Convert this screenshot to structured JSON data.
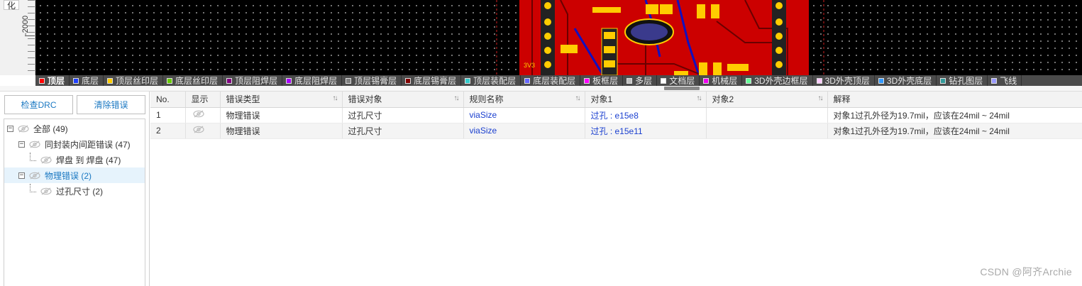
{
  "ruler": {
    "button_label": "化",
    "mark_label": "-2000"
  },
  "canvas": {
    "silk_label": "3V3"
  },
  "layers": [
    {
      "name": "顶层",
      "color": "#ff0000",
      "active": true
    },
    {
      "name": "底层",
      "color": "#1f3fff",
      "active": false
    },
    {
      "name": "顶层丝印层",
      "color": "#ffcc00",
      "active": false
    },
    {
      "name": "底层丝印层",
      "color": "#66cc00",
      "active": false
    },
    {
      "name": "顶层阻焊层",
      "color": "#800080",
      "active": false
    },
    {
      "name": "底层阻焊层",
      "color": "#aa00ff",
      "active": false
    },
    {
      "name": "顶层锡膏层",
      "color": "#808080",
      "active": false
    },
    {
      "name": "底层锡膏层",
      "color": "#800000",
      "active": false
    },
    {
      "name": "顶层装配层",
      "color": "#33cccc",
      "active": false
    },
    {
      "name": "底层装配层",
      "color": "#6666ff",
      "active": false
    },
    {
      "name": "板框层",
      "color": "#ff00ff",
      "active": false
    },
    {
      "name": "多层",
      "color": "#c0c0c0",
      "active": false
    },
    {
      "name": "文档层",
      "color": "#ffffff",
      "active": false
    },
    {
      "name": "机械层",
      "color": "#f000f0",
      "active": false
    },
    {
      "name": "3D外壳边框层",
      "color": "#66ff99",
      "active": false
    },
    {
      "name": "3D外壳顶层",
      "color": "#ffccff",
      "active": false
    },
    {
      "name": "3D外壳底层",
      "color": "#3399ff",
      "active": false
    },
    {
      "name": "钻孔图层",
      "color": "#339999",
      "active": false
    },
    {
      "name": "飞线",
      "color": "#9999ff",
      "active": false
    }
  ],
  "drc_panel": {
    "check_label": "检查DRC",
    "clear_label": "清除错误",
    "tree": [
      {
        "label": "全部 (49)",
        "level": 0,
        "expander": "−",
        "selected": false
      },
      {
        "label": "同封装内间距错误 (47)",
        "level": 1,
        "expander": "−",
        "selected": false
      },
      {
        "label": "焊盘 到 焊盘 (47)",
        "level": 2,
        "expander": "",
        "selected": false
      },
      {
        "label": "物理错误 (2)",
        "level": 1,
        "expander": "−",
        "selected": true
      },
      {
        "label": "过孔尺寸 (2)",
        "level": 2,
        "expander": "",
        "selected": false
      }
    ]
  },
  "table": {
    "columns": [
      "No.",
      "显示",
      "错误类型",
      "错误对象",
      "规则名称",
      "对象1",
      "对象2",
      "解释"
    ],
    "sortable": [
      false,
      false,
      true,
      true,
      true,
      true,
      true,
      false
    ],
    "rows": [
      {
        "no": "1",
        "type": "物理错误",
        "object": "过孔尺寸",
        "rule": "viaSize",
        "obj1": "过孔 : e15e8",
        "obj2": "",
        "explain": "对象1过孔外径为19.7mil，应该在24mil ~ 24mil"
      },
      {
        "no": "2",
        "type": "物理错误",
        "object": "过孔尺寸",
        "rule": "viaSize",
        "obj1": "过孔 : e15e11",
        "obj2": "",
        "explain": "对象1过孔外径为19.7mil，应该在24mil ~ 24mil"
      }
    ]
  },
  "watermark": "CSDN @阿齐Archie"
}
